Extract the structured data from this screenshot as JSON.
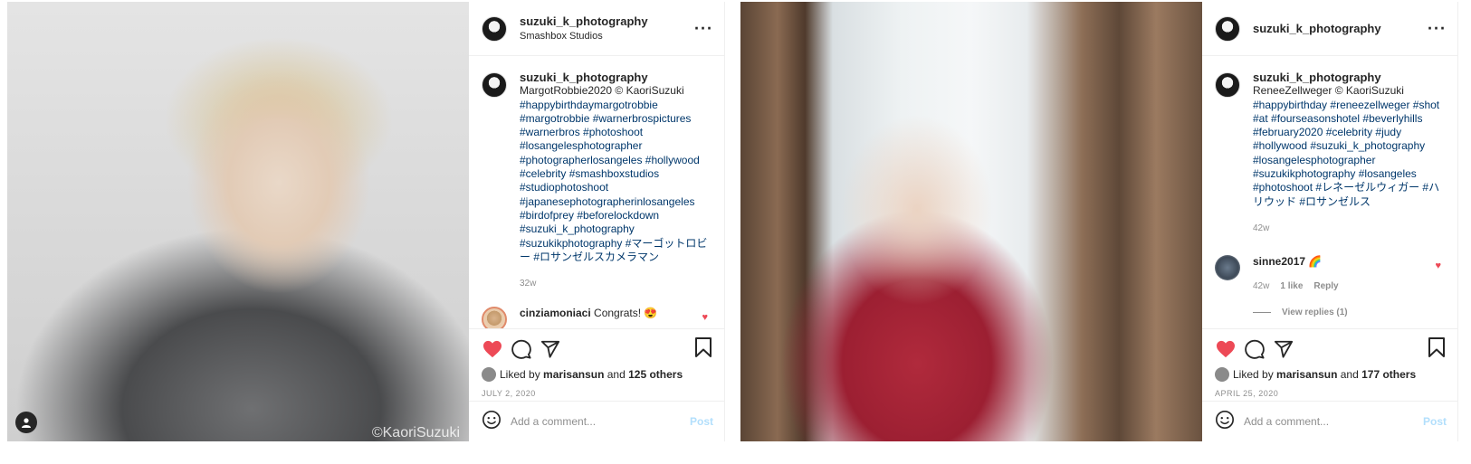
{
  "posts": [
    {
      "header": {
        "username": "suzuki_k_photography",
        "location": "Smashbox Studios"
      },
      "photo_watermark": "©KaoriSuzuki",
      "caption": {
        "username": "suzuki_k_photography",
        "text": "MargotRobbie2020 © KaoriSuzuki",
        "hashtags": "#happybirthdaymargotrobbie #margotrobbie #warnerbrospictures #warnerbros #photoshoot #losangelesphotographer #photographerlosangeles #hollywood #celebrity #smashboxstudios #studiophotoshoot #japanesephotographerinlosangeles #birdofprey #beforelockdown #suzuki_k_photography #suzukikphotography #マーゴットロビー #ロサンゼルスカメラマン",
        "age": "32w"
      },
      "comment": {
        "username": "cinziamoniaci",
        "text": "Congrats! 😍"
      },
      "likes": {
        "prefix": "Liked by",
        "user": "marisansun",
        "joiner": "and",
        "others": "125 others"
      },
      "date": "JULY 2, 2020",
      "add_comment": {
        "placeholder": "Add a comment...",
        "post_label": "Post"
      }
    },
    {
      "header": {
        "username": "suzuki_k_photography"
      },
      "caption": {
        "username": "suzuki_k_photography",
        "text": "ReneeZellweger © KaoriSuzuki",
        "hashtags": "#happybirthday #reneezellweger #shot #at #fourseasonshotel #beverlyhills #february2020 #celebrity #judy #hollywood #suzuki_k_photography #losangelesphotographer #suzukikphotography #losangeles #photoshoot #レネーゼルウィガー #ハリウッド #ロサンゼルス",
        "age": "42w"
      },
      "comment": {
        "username": "sinne2017",
        "text": "🌈",
        "time": "42w",
        "likes": "1 like",
        "reply": "Reply",
        "view_replies": "View replies (1)"
      },
      "likes": {
        "prefix": "Liked by",
        "user": "marisansun",
        "joiner": "and",
        "others": "177 others"
      },
      "date": "APRIL 25, 2020",
      "add_comment": {
        "placeholder": "Add a comment...",
        "post_label": "Post"
      }
    }
  ],
  "colors": {
    "like_red": "#ed4956",
    "hashtag_blue": "#00376b",
    "muted_gray": "#8e8e8e",
    "post_disabled": "#b2dffc"
  },
  "icons": [
    "heart-icon",
    "comment-icon",
    "share-icon",
    "bookmark-icon",
    "more-icon",
    "emoji-icon",
    "user-icon"
  ]
}
